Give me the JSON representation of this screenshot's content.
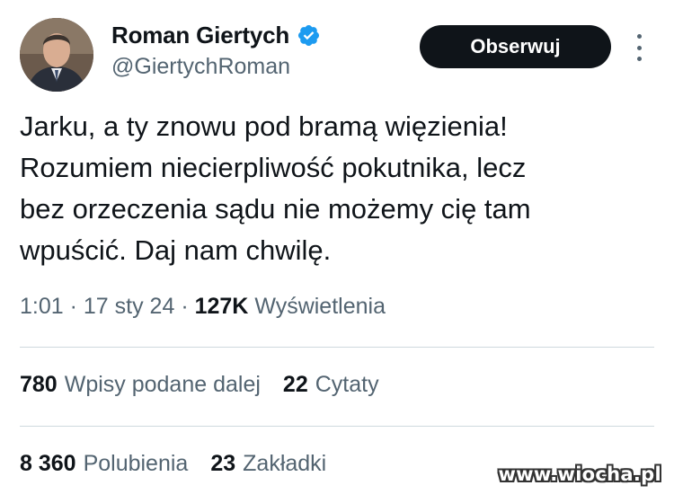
{
  "author": {
    "name": "Roman Giertych",
    "handle": "@GiertychRoman",
    "verified_color": "#1d9bf0"
  },
  "follow_button_label": "Obserwuj",
  "more_icon": "more-vertical-icon",
  "tweet": {
    "lines": [
      "Jarku, a ty znowu pod bramą więzienia!",
      "Rozumiem niecierpliwość pokutnika, lecz",
      "bez orzeczenia sądu nie możemy cię tam",
      "wpuścić. Daj nam chwilę."
    ]
  },
  "meta": {
    "time": "1:01",
    "separator": "·",
    "date": "17 sty 24",
    "views_count": "127K",
    "views_label": "Wyświetlenia"
  },
  "stats_row1": [
    {
      "num": "780",
      "label": "Wpisy podane dalej"
    },
    {
      "num": "22",
      "label": "Cytaty"
    }
  ],
  "stats_row2": [
    {
      "num": "8 360",
      "label": "Polubienia"
    },
    {
      "num": "23",
      "label": "Zakładki"
    }
  ],
  "watermark": "www.wiocha.pl"
}
